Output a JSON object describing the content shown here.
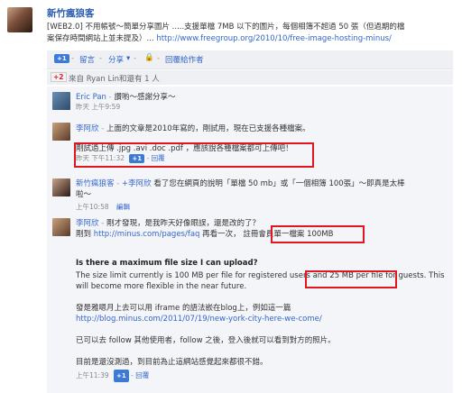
{
  "post": {
    "author": "新竹瘋狼客",
    "body_line1": "[WEB2.0] 不用帳號～簡單分享圖片 .....支援單檔 7MB 以下的圖片，每個相簿不超過 50 張（但過期的檔",
    "body_line2_prefix": "案保存時間網站上並未提及）...",
    "body_link": "http://www.freegroup.org/2010/10/free-image-hosting-minus/",
    "plus_label": "+1",
    "comment_label": "留言",
    "share_label": "分享",
    "reply_label": "回覆給作者",
    "plus_count": "+2",
    "plus_text": "來自 Ryan Lin和還有 1 人"
  },
  "comments": [
    {
      "name": "Eric Pan",
      "text": "讚喲～感謝分享～",
      "time": "昨天 上午9:59"
    },
    {
      "name": "李阿欣",
      "text": "上面的文章是2010年寫的，剛試用，現在已支援各種檔案。",
      "text2": "剛試過上傳 .jpg .avi .doc .pdf ，應該說各種檔案都可上傳吧！",
      "time": "昨天 下午11:32",
      "plus_label": "+1",
      "reply_label": "回覆"
    },
    {
      "name": "新竹瘋狼客",
      "mention": "李阿欣",
      "text": "看了您在網頁的說明「單檔 50 mb」或「一個相簿 100張」～即真是太棒",
      "text_cont": "啦～",
      "time": "上午10:58",
      "edit_label": "編輯"
    },
    {
      "name": "李阿欣",
      "text": "剛才發現，是我昨天好像眼誤，還是改的了？",
      "prefix": "剛到",
      "link": "http://minus.com/pages/faq",
      "middle": "再看一次，",
      "highlight": "註冊會員單一檔案 100MB",
      "question": "Is there a maximum file size I can upload?",
      "answer_a": "The size limit currently is 100 MB per file for registered users and",
      "answer_hl": "25 MB per file for guests.",
      "answer_b": "This",
      "answer_c": "will become more flexible in the near future.",
      "p2": "發是雅嗯月上去可以用 iframe 的語法嵌在blog上，例如這一篇",
      "p2_link": "http://blog.minus.com/2011/07/19/new-york-city-here-we-come/",
      "p3": "已可以去 follow 其他使用者，follow 之後，登入後就可以看到對方的照片。",
      "p4": "目前是還沒測過，到目前為止這網站感覺起來都很不錯。",
      "time": "上午11:39",
      "plus_label": "+1",
      "reply_label": "回覆"
    }
  ]
}
